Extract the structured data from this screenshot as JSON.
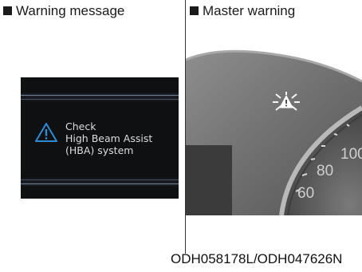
{
  "sections": {
    "left_title": "Warning message",
    "right_title": "Master warning"
  },
  "warning_panel": {
    "lines": [
      "Check",
      "High Beam Assist",
      "(HBA) system"
    ],
    "icon": "warning-triangle-icon",
    "accent": "#2e8bd6"
  },
  "cluster": {
    "icon": "master-warning-icon",
    "speed_labels": [
      "100",
      "80",
      "60"
    ]
  },
  "footer": {
    "code": "ODH058178L/ODH047626N"
  }
}
